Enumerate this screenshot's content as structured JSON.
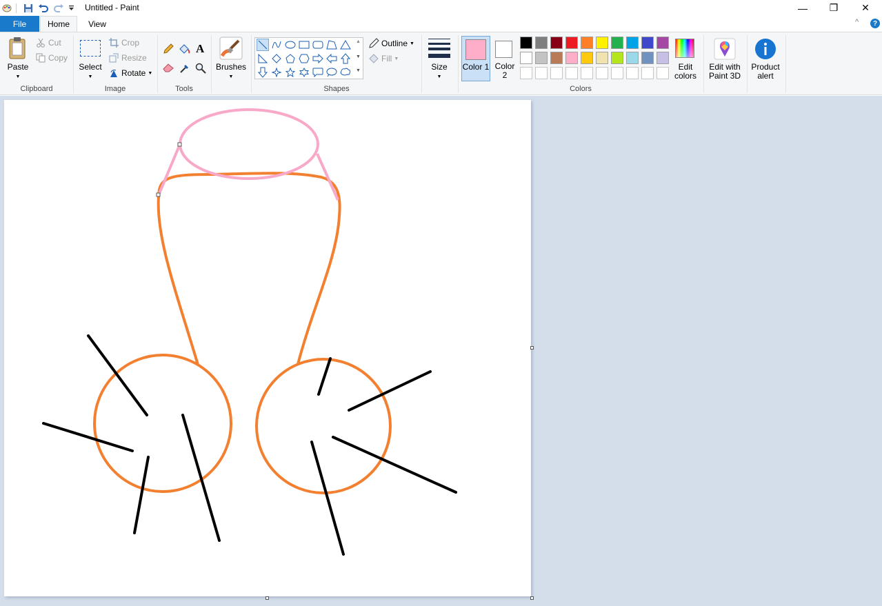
{
  "window": {
    "title": "Untitled - Paint",
    "minimize": "—",
    "restore": "❐",
    "close": "✕"
  },
  "tabs": {
    "file": "File",
    "home": "Home",
    "view": "View"
  },
  "help": {
    "collapse": "^",
    "help": "?"
  },
  "clipboard": {
    "paste": "Paste",
    "cut": "Cut",
    "copy": "Copy",
    "group": "Clipboard"
  },
  "image": {
    "select": "Select",
    "crop": "Crop",
    "resize": "Resize",
    "rotate": "Rotate",
    "group": "Image"
  },
  "tools": {
    "group": "Tools",
    "text_glyph": "A"
  },
  "brushes": {
    "label": "Brushes"
  },
  "shapes": {
    "outline": "Outline",
    "fill": "Fill",
    "group": "Shapes"
  },
  "size": {
    "label": "Size"
  },
  "colors": {
    "color1_label": "Color 1",
    "color2_label": "Color 2",
    "color1_value": "#ffaec9",
    "color2_value": "#ffffff",
    "edit_colors": "Edit colors",
    "group": "Colors",
    "palette_row1": [
      "#000000",
      "#7f7f7f",
      "#880015",
      "#ed1c24",
      "#ff7f27",
      "#fff200",
      "#22b14c",
      "#00a2e8",
      "#3f48cc",
      "#a349a4"
    ],
    "palette_row2": [
      "#ffffff",
      "#c3c3c3",
      "#b97a57",
      "#ffaec9",
      "#ffc90e",
      "#efe4b0",
      "#b5e61d",
      "#99d9ea",
      "#7092be",
      "#c8bfe7"
    ],
    "palette_row3": [
      "#ffffff",
      "#ffffff",
      "#ffffff",
      "#ffffff",
      "#ffffff",
      "#ffffff",
      "#ffffff",
      "#ffffff",
      "#ffffff",
      "#ffffff"
    ]
  },
  "paint3d": {
    "label": "Edit with Paint 3D"
  },
  "product_alert": {
    "label": "Product alert"
  },
  "drawing": {
    "pink": "#f8a8c8",
    "orange": "#f28030",
    "black": "#000000"
  }
}
